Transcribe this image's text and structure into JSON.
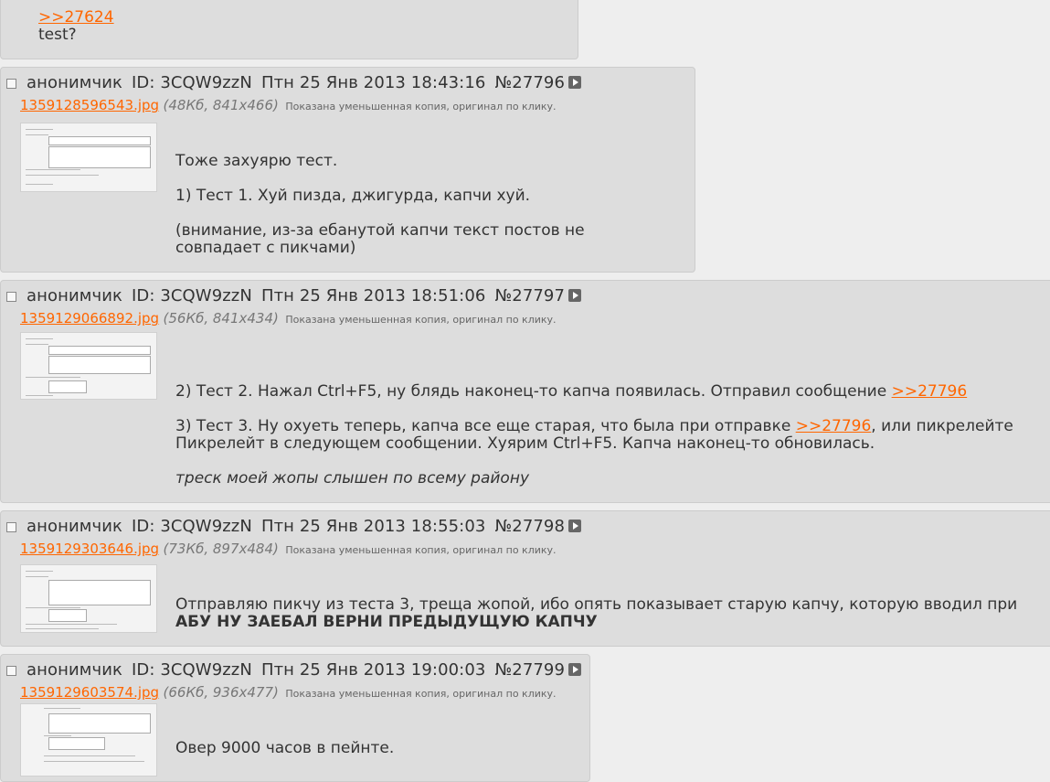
{
  "top_post": {
    "reply_link": ">>27624",
    "message": "test?"
  },
  "posts": [
    {
      "author": "анонимчик",
      "id": "ID: 3CQW9zzN",
      "date": "Птн 25 Янв 2013 18:43:16",
      "number": "№27796",
      "file": {
        "name": "1359128596543.jpg",
        "meta": "(48Кб, 841x466)",
        "note": "Показана уменьшенная копия, оригинал по клику."
      },
      "lines": [
        "Тоже захуярю тест.",
        "1) Тест 1. Хуй пизда, джигурда, капчи хуй.",
        "(внимание, из-за ебанутой капчи текст постов не",
        "совпадает с пикчами)"
      ]
    },
    {
      "author": "анонимчик",
      "id": "ID: 3CQW9zzN",
      "date": "Птн 25 Янв 2013 18:51:06",
      "number": "№27797",
      "file": {
        "name": "1359129066892.jpg",
        "meta": "(56Кб, 841x434)",
        "note": "Показана уменьшенная копия, оригинал по клику."
      },
      "line1_text": "2) Тест 2. Нажал Ctrl+F5, ну блядь наконец-то капча появилась. Отправил сообщение ",
      "line1_link": ">>27796",
      "line2_text": "3) Тест 3. Ну охуеть теперь, капча все еще старая, что была при отправке ",
      "line2_link": ">>27796",
      "line2_tail": ", или пикрелейте",
      "line3": "Пикрелейт в следующем сообщении. Хуярим Ctrl+F5. Капча наконец-то обновилась.",
      "line4": "треск моей жопы слышен по всему району"
    },
    {
      "author": "анонимчик",
      "id": "ID: 3CQW9zzN",
      "date": "Птн 25 Янв 2013 18:55:03",
      "number": "№27798",
      "file": {
        "name": "1359129303646.jpg",
        "meta": "(73Кб, 897x484)",
        "note": "Показана уменьшенная копия, оригинал по клику."
      },
      "line1": "Отправляю пикчу из теста 3, треща жопой, ибо опять показывает старую капчу, которую вводил при",
      "line2": "АБУ НУ ЗАЕБАЛ ВЕРНИ ПРЕДЫДУЩУЮ КАПЧУ"
    },
    {
      "author": "анонимчик",
      "id": "ID: 3CQW9zzN",
      "date": "Птн 25 Янв 2013 19:00:03",
      "number": "№27799",
      "file": {
        "name": "1359129603574.jpg",
        "meta": "(66Кб, 936x477)",
        "note": "Показана уменьшенная копия, оригинал по клику."
      },
      "line1": "Овер 9000 часов в пейнте."
    }
  ]
}
